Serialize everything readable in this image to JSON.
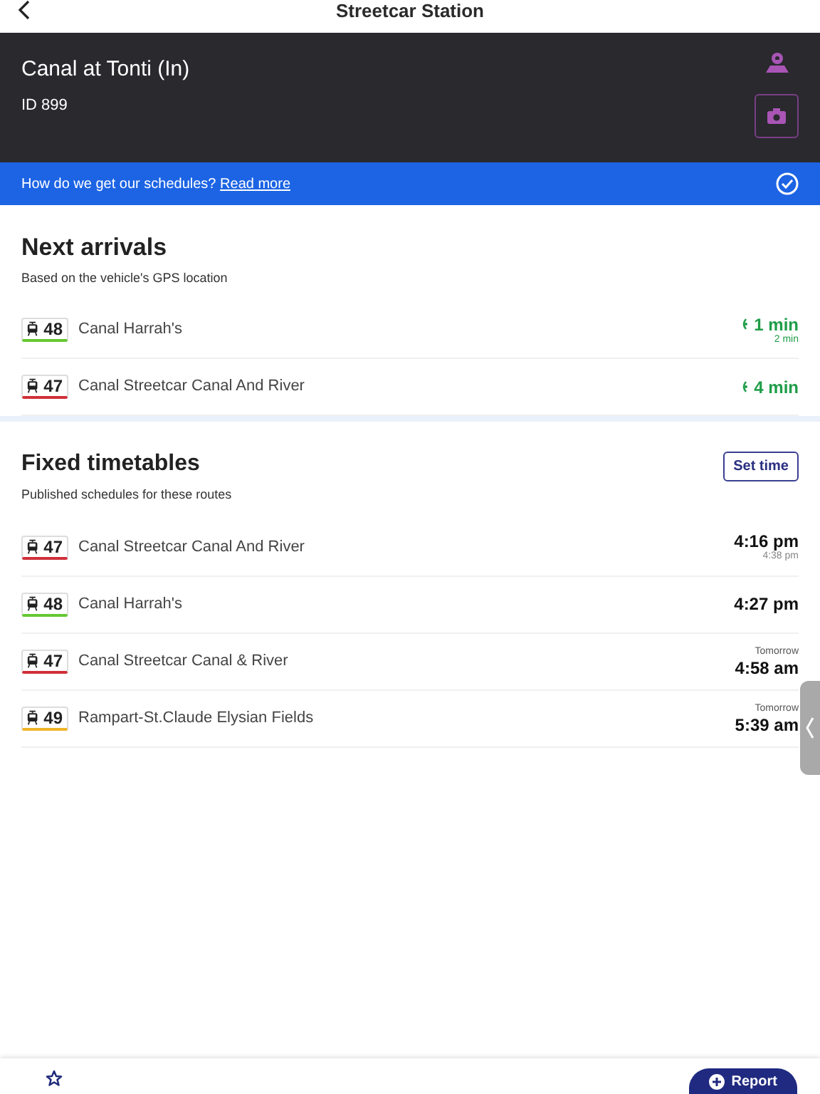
{
  "nav": {
    "title": "Streetcar Station"
  },
  "stop": {
    "name": "Canal at Tonti (In)",
    "id": "ID 899"
  },
  "banner": {
    "text": "How do we get our schedules?",
    "link": "Read more"
  },
  "next_arrivals": {
    "title": "Next arrivals",
    "subtitle": "Based on the vehicle's GPS location",
    "rows": [
      {
        "route": "48",
        "color": "#65c832",
        "destination": "Canal Harrah's",
        "time": "1 min",
        "next": "2 min"
      },
      {
        "route": "47",
        "color": "#d0303a",
        "destination": "Canal Streetcar Canal And River",
        "time": "4 min"
      }
    ]
  },
  "fixed_timetables": {
    "title": "Fixed timetables",
    "subtitle": "Published schedules for these routes",
    "button": "Set time",
    "rows": [
      {
        "route": "47",
        "color": "#d0303a",
        "destination": "Canal Streetcar Canal And River",
        "time": "4:16 pm",
        "next": "4:38 pm"
      },
      {
        "route": "48",
        "color": "#65c832",
        "destination": "Canal Harrah's",
        "time": "4:27 pm"
      },
      {
        "route": "47",
        "color": "#d0303a",
        "destination": "Canal Streetcar Canal & River",
        "day": "Tomorrow",
        "time": "4:58 am"
      },
      {
        "route": "49",
        "color": "#f0b428",
        "destination": "Rampart-St.Claude Elysian Fields",
        "day": "Tomorrow",
        "time": "5:39 am"
      }
    ]
  },
  "footer": {
    "button": "Report"
  }
}
